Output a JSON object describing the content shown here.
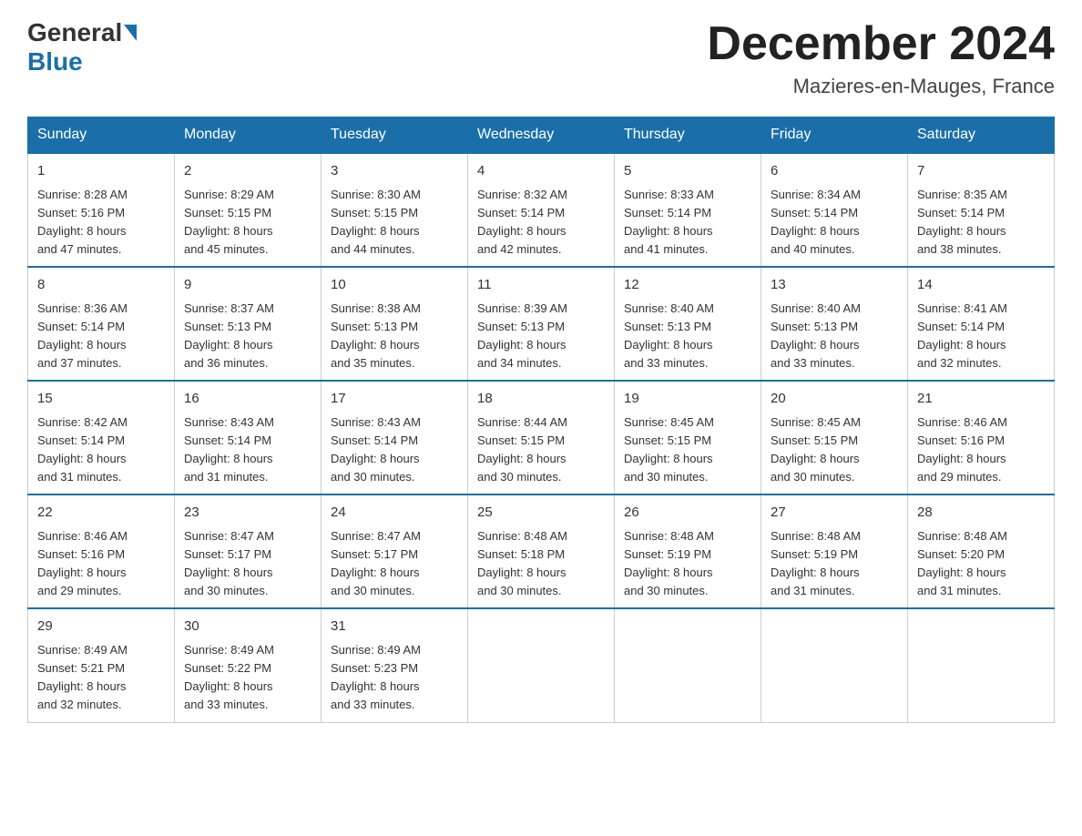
{
  "logo": {
    "general": "General",
    "blue": "Blue"
  },
  "title": "December 2024",
  "location": "Mazieres-en-Mauges, France",
  "days_of_week": [
    "Sunday",
    "Monday",
    "Tuesday",
    "Wednesday",
    "Thursday",
    "Friday",
    "Saturday"
  ],
  "weeks": [
    [
      {
        "day": "1",
        "sunrise": "8:28 AM",
        "sunset": "5:16 PM",
        "daylight": "8 hours and 47 minutes."
      },
      {
        "day": "2",
        "sunrise": "8:29 AM",
        "sunset": "5:15 PM",
        "daylight": "8 hours and 45 minutes."
      },
      {
        "day": "3",
        "sunrise": "8:30 AM",
        "sunset": "5:15 PM",
        "daylight": "8 hours and 44 minutes."
      },
      {
        "day": "4",
        "sunrise": "8:32 AM",
        "sunset": "5:14 PM",
        "daylight": "8 hours and 42 minutes."
      },
      {
        "day": "5",
        "sunrise": "8:33 AM",
        "sunset": "5:14 PM",
        "daylight": "8 hours and 41 minutes."
      },
      {
        "day": "6",
        "sunrise": "8:34 AM",
        "sunset": "5:14 PM",
        "daylight": "8 hours and 40 minutes."
      },
      {
        "day": "7",
        "sunrise": "8:35 AM",
        "sunset": "5:14 PM",
        "daylight": "8 hours and 38 minutes."
      }
    ],
    [
      {
        "day": "8",
        "sunrise": "8:36 AM",
        "sunset": "5:14 PM",
        "daylight": "8 hours and 37 minutes."
      },
      {
        "day": "9",
        "sunrise": "8:37 AM",
        "sunset": "5:13 PM",
        "daylight": "8 hours and 36 minutes."
      },
      {
        "day": "10",
        "sunrise": "8:38 AM",
        "sunset": "5:13 PM",
        "daylight": "8 hours and 35 minutes."
      },
      {
        "day": "11",
        "sunrise": "8:39 AM",
        "sunset": "5:13 PM",
        "daylight": "8 hours and 34 minutes."
      },
      {
        "day": "12",
        "sunrise": "8:40 AM",
        "sunset": "5:13 PM",
        "daylight": "8 hours and 33 minutes."
      },
      {
        "day": "13",
        "sunrise": "8:40 AM",
        "sunset": "5:13 PM",
        "daylight": "8 hours and 33 minutes."
      },
      {
        "day": "14",
        "sunrise": "8:41 AM",
        "sunset": "5:14 PM",
        "daylight": "8 hours and 32 minutes."
      }
    ],
    [
      {
        "day": "15",
        "sunrise": "8:42 AM",
        "sunset": "5:14 PM",
        "daylight": "8 hours and 31 minutes."
      },
      {
        "day": "16",
        "sunrise": "8:43 AM",
        "sunset": "5:14 PM",
        "daylight": "8 hours and 31 minutes."
      },
      {
        "day": "17",
        "sunrise": "8:43 AM",
        "sunset": "5:14 PM",
        "daylight": "8 hours and 30 minutes."
      },
      {
        "day": "18",
        "sunrise": "8:44 AM",
        "sunset": "5:15 PM",
        "daylight": "8 hours and 30 minutes."
      },
      {
        "day": "19",
        "sunrise": "8:45 AM",
        "sunset": "5:15 PM",
        "daylight": "8 hours and 30 minutes."
      },
      {
        "day": "20",
        "sunrise": "8:45 AM",
        "sunset": "5:15 PM",
        "daylight": "8 hours and 30 minutes."
      },
      {
        "day": "21",
        "sunrise": "8:46 AM",
        "sunset": "5:16 PM",
        "daylight": "8 hours and 29 minutes."
      }
    ],
    [
      {
        "day": "22",
        "sunrise": "8:46 AM",
        "sunset": "5:16 PM",
        "daylight": "8 hours and 29 minutes."
      },
      {
        "day": "23",
        "sunrise": "8:47 AM",
        "sunset": "5:17 PM",
        "daylight": "8 hours and 30 minutes."
      },
      {
        "day": "24",
        "sunrise": "8:47 AM",
        "sunset": "5:17 PM",
        "daylight": "8 hours and 30 minutes."
      },
      {
        "day": "25",
        "sunrise": "8:48 AM",
        "sunset": "5:18 PM",
        "daylight": "8 hours and 30 minutes."
      },
      {
        "day": "26",
        "sunrise": "8:48 AM",
        "sunset": "5:19 PM",
        "daylight": "8 hours and 30 minutes."
      },
      {
        "day": "27",
        "sunrise": "8:48 AM",
        "sunset": "5:19 PM",
        "daylight": "8 hours and 31 minutes."
      },
      {
        "day": "28",
        "sunrise": "8:48 AM",
        "sunset": "5:20 PM",
        "daylight": "8 hours and 31 minutes."
      }
    ],
    [
      {
        "day": "29",
        "sunrise": "8:49 AM",
        "sunset": "5:21 PM",
        "daylight": "8 hours and 32 minutes."
      },
      {
        "day": "30",
        "sunrise": "8:49 AM",
        "sunset": "5:22 PM",
        "daylight": "8 hours and 33 minutes."
      },
      {
        "day": "31",
        "sunrise": "8:49 AM",
        "sunset": "5:23 PM",
        "daylight": "8 hours and 33 minutes."
      },
      null,
      null,
      null,
      null
    ]
  ],
  "labels": {
    "sunrise": "Sunrise:",
    "sunset": "Sunset:",
    "daylight": "Daylight:"
  }
}
